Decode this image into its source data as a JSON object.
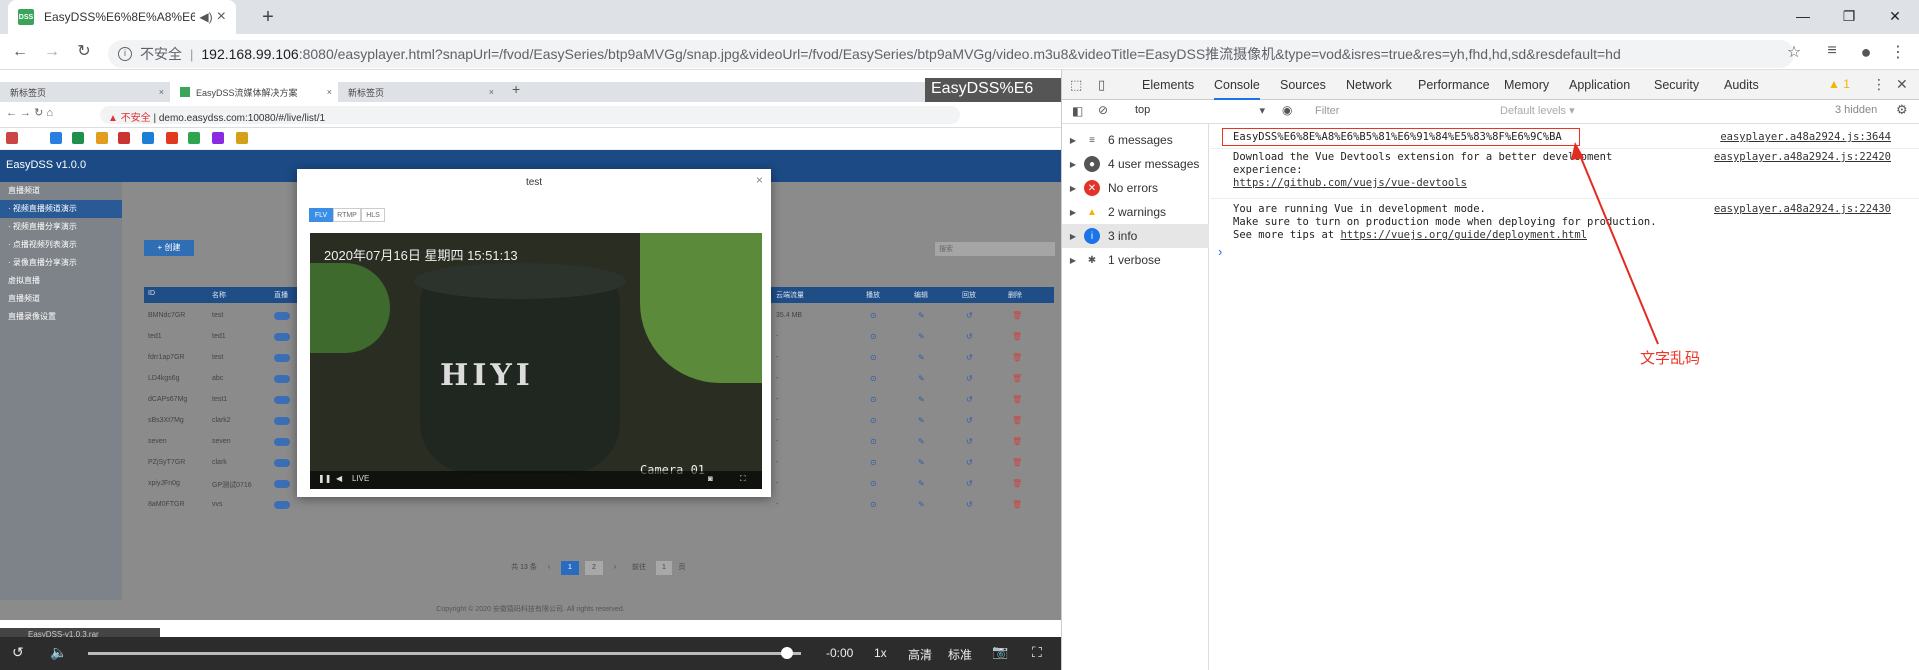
{
  "browser": {
    "tab_title": "EasyDSS%E6%8E%A8%E6%B5%81",
    "new_tab": "+",
    "window_min": "—",
    "window_max": "❐",
    "window_close": "✕",
    "insecure_label": "不安全",
    "url_host": "192.168.99.106",
    "url_rest": ":8080/easyplayer.html?snapUrl=/fvod/EasySeries/btp9aMVGg/snap.jpg&videoUrl=/fvod/EasySeries/btp9aMVGg/video.m3u8&videoTitle=EasyDSS推流摄像机&type=vod&isres=true&res=yh,fhd,hd,sd&resdefault=hd"
  },
  "inner": {
    "tabs": [
      "新标签页",
      "EasyDSS流媒体解决方案",
      "新标签页"
    ],
    "watermark": "EasyDSS%E6",
    "address_warn": "▲ 不安全",
    "address": "demo.easydss.com:10080/#/live/list/1",
    "logo": "EasyDSS v1.0.0",
    "sidebar": [
      "直播频道",
      "· 视频直播频道演示",
      "· 视频直播分享演示",
      "· 点播视频列表演示",
      "· 录像直播分享演示",
      "虚拟直播",
      "直播频道",
      "直播录像设置"
    ],
    "add_button": "+ 创建",
    "search_placeholder": "搜索",
    "table_headers": [
      "ID",
      "名称",
      "直播",
      "",
      "",
      "",
      "",
      "",
      "",
      "云端流量",
      "",
      "播放",
      "编辑",
      "回放",
      "删除"
    ],
    "rows": [
      {
        "id": "BMNdc7GR",
        "name": "test",
        "size": "35.4 MB"
      },
      {
        "id": "ted1",
        "name": "ted1",
        "size": "-"
      },
      {
        "id": "fdrr1ap7GR",
        "name": "test",
        "size": "-"
      },
      {
        "id": "LD4kgs6g",
        "name": "abc",
        "size": "-"
      },
      {
        "id": "dCAPs67Mg",
        "name": "test1",
        "size": "-"
      },
      {
        "id": "sBs3Xt7Mg",
        "name": "clark2",
        "size": "-"
      },
      {
        "id": "seven",
        "name": "seven",
        "size": "-"
      },
      {
        "id": "PZjSyT7GR",
        "name": "clark",
        "size": "-"
      },
      {
        "id": "xpiyJFn0g",
        "name": "GP测试0716",
        "size": "-"
      },
      {
        "id": "8aM0FTGR",
        "name": "vvs",
        "size": "-"
      }
    ],
    "pagination": {
      "total": "共 13 条",
      "prev": "‹",
      "pages": [
        "1",
        "2"
      ],
      "next": "›",
      "goto": "前往",
      "page_input": "1",
      "page_unit": "页"
    },
    "footer": "Copyright © 2020 安徽猿码科技有限公司. All rights reserved.",
    "modal": {
      "title": "test",
      "close": "×",
      "protocols": [
        "FLV",
        "RTMP",
        "HLS"
      ],
      "timestamp": "2020年07月16日  星期四  15:51:13",
      "pot_label": "HIYI",
      "camera_label": "Camera 01",
      "live": "LIVE"
    },
    "download": "EasyDSS-v1.0.3.rar"
  },
  "player": {
    "time": "-0:00",
    "speed": "1x",
    "quality_hd": "高清",
    "quality_sd": "标准",
    "progress": 0.98
  },
  "devtools": {
    "tabs": [
      "Elements",
      "Console",
      "Sources",
      "Network",
      "Performance",
      "Memory",
      "Application",
      "Security",
      "Audits"
    ],
    "active_tab": "Console",
    "warning_count": "1",
    "context": "top",
    "filter_placeholder": "Filter",
    "levels": "Default levels ▾",
    "hidden": "3 hidden",
    "sidebar": [
      {
        "label": "6 messages",
        "icon": "list-icon",
        "color": "#555555"
      },
      {
        "label": "4 user messages",
        "icon": "user-icon",
        "color": "#555555"
      },
      {
        "label": "No errors",
        "icon": "error-icon",
        "color": "#e0342b"
      },
      {
        "label": "2 warnings",
        "icon": "warning-icon",
        "color": "#f2b600"
      },
      {
        "label": "3 info",
        "icon": "info-icon",
        "color": "#1a73e8"
      },
      {
        "label": "1 verbose",
        "icon": "bug-icon",
        "color": "#555555"
      }
    ],
    "messages": [
      {
        "lines": [
          "EasyDSS%E6%8E%A8%E6%B5%81%E6%91%84%E5%83%8F%E6%9C%BA"
        ],
        "source": "easyplayer.a48a2924.js:3644"
      },
      {
        "lines": [
          "Download the Vue Devtools extension for a better development",
          "experience:",
          "https://github.com/vuejs/vue-devtools"
        ],
        "source": "easyplayer.a48a2924.js:22420"
      },
      {
        "lines": [
          "You are running Vue in development mode.",
          "Make sure to turn on production mode when deploying for production.",
          "See more tips at https://vuejs.org/guide/deployment.html"
        ],
        "source": "easyplayer.a48a2924.js:22430"
      }
    ],
    "prompt": "›"
  },
  "annotation": {
    "text": "文字乱码",
    "color": "#e32b22"
  }
}
